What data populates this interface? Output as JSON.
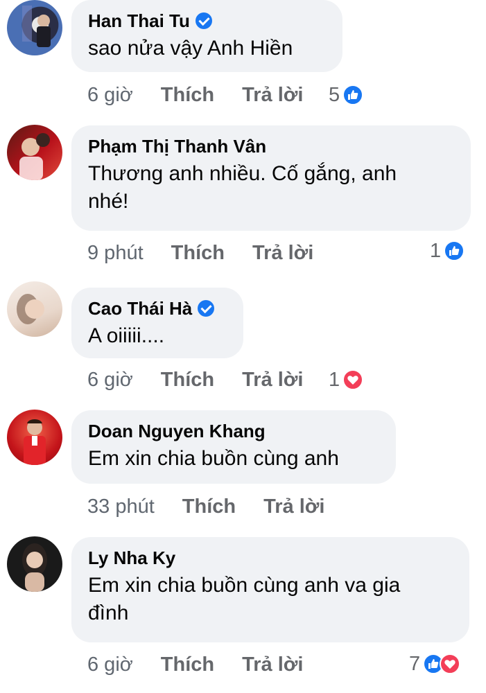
{
  "comments": [
    {
      "name": "Han Thai Tu",
      "verified": true,
      "text": "sao nửa vậy Anh Hiền",
      "time": "6 giờ",
      "like": "Thích",
      "reply": "Trả lời",
      "reaction_count": "5",
      "reactions": [
        "like"
      ],
      "avatar_colors": [
        "#4a6fb4",
        "#e8e8e8"
      ]
    },
    {
      "name": "Phạm Thị Thanh Vân",
      "verified": false,
      "text_lines": [
        "Thương anh nhiều. Cố gắng, anh",
        "nhé!"
      ],
      "time": "9 phút",
      "like": "Thích",
      "reply": "Trả lời",
      "reaction_count": "1",
      "reactions": [
        "like"
      ],
      "avatar_colors": [
        "#b8121b",
        "#5a1a14"
      ]
    },
    {
      "name": "Cao Thái Hà",
      "verified": true,
      "text": "A oiiiii....",
      "time": "6 giờ",
      "like": "Thích",
      "reply": "Trả lời",
      "reaction_count": "1",
      "reactions": [
        "love"
      ],
      "avatar_colors": [
        "#e9d8cc",
        "#b68a6e"
      ]
    },
    {
      "name": "Doan Nguyen Khang",
      "verified": false,
      "text": "Em xin chia buồn cùng anh",
      "time": "33 phút",
      "like": "Thích",
      "reply": "Trả lời",
      "avatar_colors": [
        "#c4141a",
        "#3a2416"
      ]
    },
    {
      "name": "Ly Nha Ky",
      "verified": false,
      "text_lines": [
        "Em xin chia buồn cùng anh va gia",
        "đình"
      ],
      "time": "6 giờ",
      "like": "Thích",
      "reply": "Trả lời",
      "reaction_count": "7",
      "reactions": [
        "like",
        "love"
      ],
      "avatar_colors": [
        "#1a1a1a",
        "#d9b9a4"
      ]
    }
  ],
  "colors": {
    "bubble": "#f0f2f5",
    "like_blue": "#1877f2",
    "love_red": "#f33e58",
    "meta_gray": "#65676b"
  }
}
